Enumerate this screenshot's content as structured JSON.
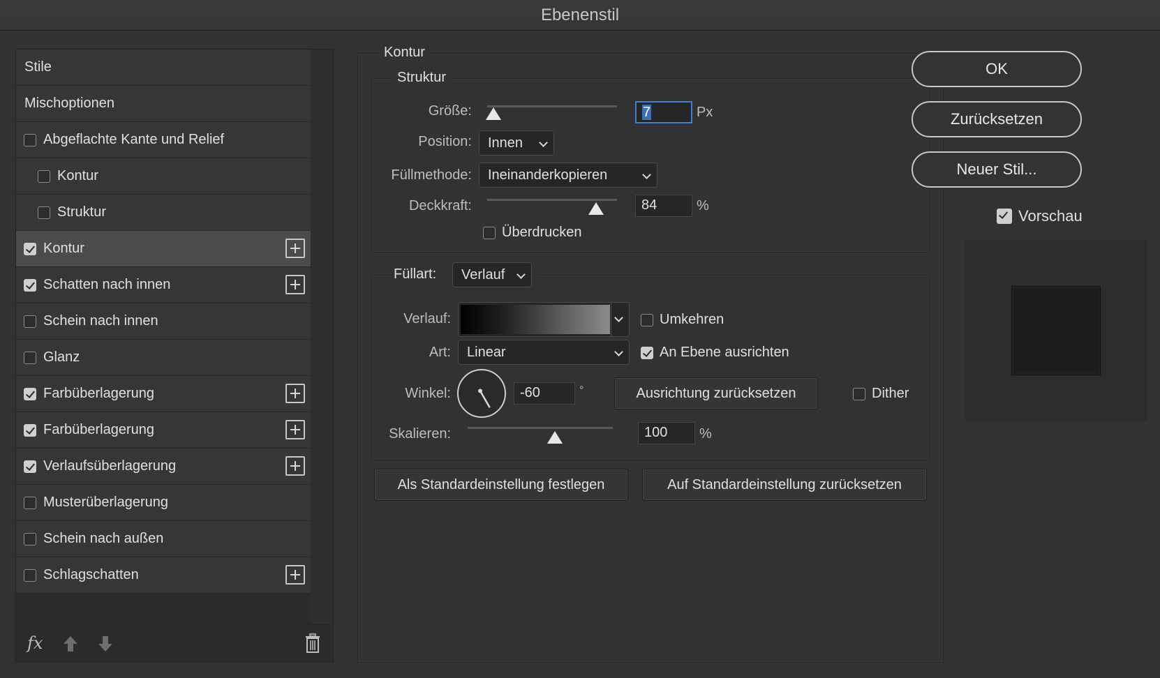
{
  "window": {
    "title": "Ebenenstil"
  },
  "styles_list": {
    "items": [
      {
        "label": "Stile",
        "checkbox": null,
        "indent": false,
        "selected": false,
        "plus": false
      },
      {
        "label": "Mischoptionen",
        "checkbox": null,
        "indent": false,
        "selected": false,
        "plus": false
      },
      {
        "label": "Abgeflachte Kante und Relief",
        "checkbox": false,
        "indent": false,
        "selected": false,
        "plus": false
      },
      {
        "label": "Kontur",
        "checkbox": false,
        "indent": true,
        "selected": false,
        "plus": false
      },
      {
        "label": "Struktur",
        "checkbox": false,
        "indent": true,
        "selected": false,
        "plus": false
      },
      {
        "label": "Kontur",
        "checkbox": true,
        "indent": false,
        "selected": true,
        "plus": true
      },
      {
        "label": "Schatten nach innen",
        "checkbox": true,
        "indent": false,
        "selected": false,
        "plus": true
      },
      {
        "label": "Schein nach innen",
        "checkbox": false,
        "indent": false,
        "selected": false,
        "plus": false
      },
      {
        "label": "Glanz",
        "checkbox": false,
        "indent": false,
        "selected": false,
        "plus": false
      },
      {
        "label": "Farbüberlagerung",
        "checkbox": true,
        "indent": false,
        "selected": false,
        "plus": true
      },
      {
        "label": "Farbüberlagerung",
        "checkbox": true,
        "indent": false,
        "selected": false,
        "plus": true
      },
      {
        "label": "Verlaufsüberlagerung",
        "checkbox": true,
        "indent": false,
        "selected": false,
        "plus": true
      },
      {
        "label": "Musterüberlagerung",
        "checkbox": false,
        "indent": false,
        "selected": false,
        "plus": false
      },
      {
        "label": "Schein nach außen",
        "checkbox": false,
        "indent": false,
        "selected": false,
        "plus": false
      },
      {
        "label": "Schlagschatten",
        "checkbox": false,
        "indent": false,
        "selected": false,
        "plus": true
      }
    ],
    "footer": {
      "fx_label": "fx"
    }
  },
  "kontur": {
    "title": "Kontur",
    "struktur": {
      "title": "Struktur",
      "size_label": "Größe:",
      "size_value": "7",
      "size_unit": "Px",
      "size_slider": 0.05,
      "position_label": "Position:",
      "position_value": "Innen",
      "blend_label": "Füllmethode:",
      "blend_value": "Ineinanderkopieren",
      "opacity_label": "Deckkraft:",
      "opacity_value": "84",
      "opacity_unit": "%",
      "opacity_slider": 0.84,
      "overprint_label": "Überdrucken",
      "overprint_checked": false
    },
    "fill": {
      "type_label": "Füllart:",
      "type_value": "Verlauf",
      "gradient_label": "Verlauf:",
      "reverse_label": "Umkehren",
      "reverse_checked": false,
      "style_label": "Art:",
      "style_value": "Linear",
      "align_label": "An Ebene ausrichten",
      "align_checked": true,
      "angle_label": "Winkel:",
      "angle_value": "-60",
      "angle_unit": "°",
      "reset_align_label": "Ausrichtung zurücksetzen",
      "dither_label": "Dither",
      "dither_checked": false,
      "scale_label": "Skalieren:",
      "scale_value": "100",
      "scale_unit": "%",
      "scale_slider": 0.6
    },
    "set_default_label": "Als Standardeinstellung festlegen",
    "reset_default_label": "Auf Standardeinstellung zurücksetzen"
  },
  "actions": {
    "ok_label": "OK",
    "reset_label": "Zurücksetzen",
    "new_style_label": "Neuer Stil...",
    "preview_label": "Vorschau",
    "preview_checked": true
  },
  "icons": [
    "fx-icon",
    "arrow-up-icon",
    "arrow-down-icon",
    "trash-icon",
    "plus-icon",
    "chevron-down-icon",
    "angle-dial-icon"
  ],
  "colors": {
    "accent": "#3f7fd4",
    "background": "#323232"
  }
}
